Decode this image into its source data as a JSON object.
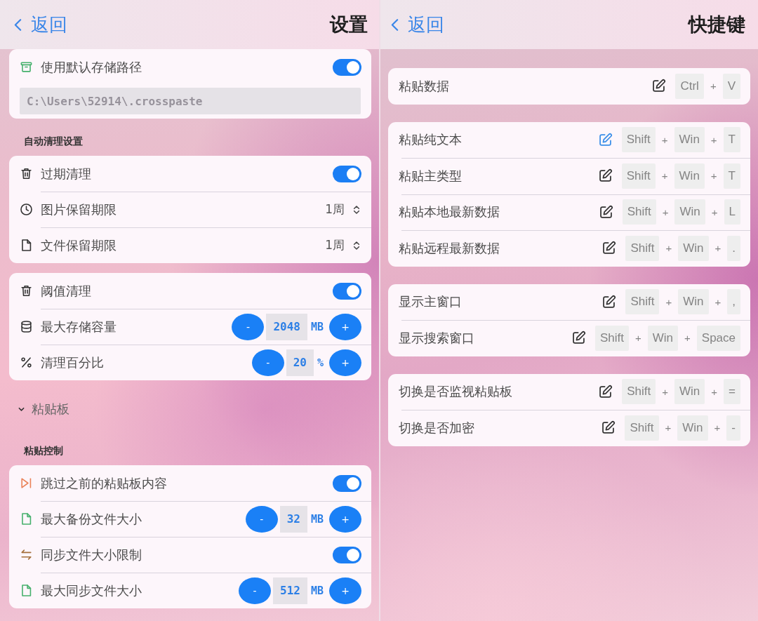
{
  "settings": {
    "back_label": "返回",
    "title": "设置",
    "blocks": [
      {
        "kind": "card",
        "rows": [
          {
            "kind": "toggle",
            "label": "使用默认存储路径",
            "on": true
          },
          {
            "kind": "path",
            "value": "C:\\Users\\52914\\.crosspaste",
            "disabled": true
          }
        ]
      },
      {
        "kind": "heading",
        "text": "自动清理设置"
      },
      {
        "kind": "card",
        "rows": [
          {
            "kind": "toggle",
            "label": "过期清理",
            "on": true
          },
          {
            "kind": "select",
            "label": "图片保留期限",
            "value": "1周"
          },
          {
            "kind": "select",
            "label": "文件保留期限",
            "value": "1周"
          }
        ]
      },
      {
        "kind": "card",
        "rows": [
          {
            "kind": "toggle",
            "label": "阈值清理",
            "on": true
          },
          {
            "kind": "stepper",
            "label": "最大存储容量",
            "decrement": "-",
            "value": "2048",
            "unit": "MB",
            "increment": "+"
          },
          {
            "kind": "stepper",
            "label": "清理百分比",
            "decrement": "-",
            "value": "20",
            "unit": "%",
            "increment": "+"
          }
        ]
      },
      {
        "kind": "group",
        "text": "粘贴板",
        "expanded": true
      },
      {
        "kind": "heading",
        "text": "粘贴控制"
      },
      {
        "kind": "card",
        "rows": [
          {
            "kind": "toggle",
            "label": "跳过之前的粘贴板内容",
            "on": true
          },
          {
            "kind": "stepper",
            "label": "最大备份文件大小",
            "decrement": "-",
            "value": "32",
            "unit": "MB",
            "increment": "+"
          },
          {
            "kind": "toggle",
            "label": "同步文件大小限制",
            "on": true
          },
          {
            "kind": "stepper",
            "label": "最大同步文件大小",
            "decrement": "-",
            "value": "512",
            "unit": "MB",
            "increment": "+"
          }
        ]
      }
    ]
  },
  "shortcuts": {
    "back_label": "返回",
    "title": "快捷键",
    "cards": [
      {
        "rows": [
          {
            "label": "粘贴数据",
            "highlighted": false,
            "combo": [
              "Ctrl",
              "+",
              "V"
            ]
          }
        ]
      },
      {
        "rows": [
          {
            "label": "粘贴纯文本",
            "highlighted": true,
            "combo": [
              "Shift",
              "+",
              "Win",
              "+",
              "T"
            ]
          },
          {
            "label": "粘贴主类型",
            "highlighted": false,
            "combo": [
              "Shift",
              "+",
              "Win",
              "+",
              "T"
            ]
          },
          {
            "label": "粘贴本地最新数据",
            "highlighted": false,
            "combo": [
              "Shift",
              "+",
              "Win",
              "+",
              "L"
            ]
          },
          {
            "label": "粘贴远程最新数据",
            "highlighted": false,
            "combo": [
              "Shift",
              "+",
              "Win",
              "+",
              "."
            ]
          }
        ]
      },
      {
        "rows": [
          {
            "label": "显示主窗口",
            "highlighted": false,
            "combo": [
              "Shift",
              "+",
              "Win",
              "+",
              ","
            ]
          },
          {
            "label": "显示搜索窗口",
            "highlighted": false,
            "combo": [
              "Shift",
              "+",
              "Win",
              "+",
              "Space"
            ]
          }
        ]
      },
      {
        "rows": [
          {
            "label": "切换是否监视粘贴板",
            "highlighted": false,
            "combo": [
              "Shift",
              "+",
              "Win",
              "+",
              "="
            ]
          },
          {
            "label": "切换是否加密",
            "highlighted": false,
            "combo": [
              "Shift",
              "+",
              "Win",
              "+",
              "-"
            ]
          }
        ]
      }
    ]
  }
}
